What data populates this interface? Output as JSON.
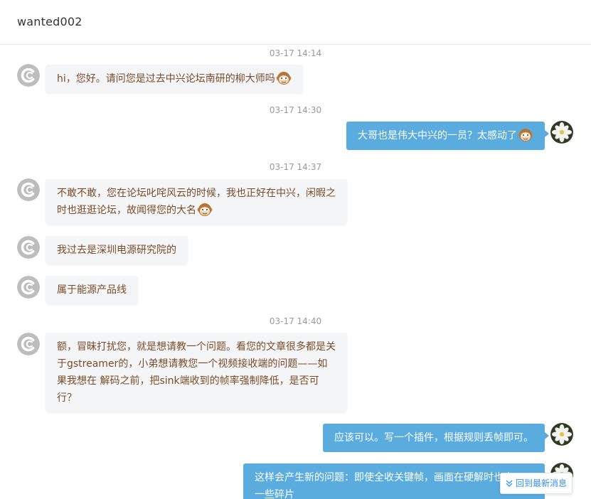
{
  "header": {
    "title": "wanted002"
  },
  "timestamps": [
    "03-17 14:14",
    "03-17 14:30",
    "03-17 14:37",
    "03-17 14:40"
  ],
  "messages": [
    {
      "text": "hi，您好。请问您是过去中兴论坛南研的柳大师吗"
    },
    {
      "text": "大哥也是伟大中兴的一员？太感动了"
    },
    {
      "line1": "不敢不敢，您在论坛叱咤风云的时候，我也正好在中兴，闲暇之",
      "line2": "时也逛逛论坛，故闻得您的大名"
    },
    {
      "text": "我过去是深圳电源研究院的"
    },
    {
      "text": "属于能源产品线"
    },
    {
      "line1": "额，冒昧打扰您，就是想请教一个问题。看您的文章很多都是关",
      "line2": "于gstreamer的，小弟想请教您一个视频接收端的问题——如",
      "line3": "果我想在  解码之前，把sink端收到的帧率强制降低，是否可",
      "line4": "行？"
    },
    {
      "text": "应该可以。写一个插件，根据规则丢帧即可。"
    },
    {
      "line1": "这样会产生新的问题：即使全收关键帧，画面在硬解时也会",
      "line2": "一些碎片"
    }
  ],
  "back_to_latest": {
    "label": "回到最新消息"
  },
  "colors": {
    "out_bubble": "#5aabde",
    "in_bubble": "#f4f5f6",
    "in_text": "#7a4b2a",
    "timestamp": "#999999"
  },
  "icons": {
    "sender_avatar": "c-logo-avatar",
    "self_avatar": "flower-avatar",
    "emoji": "monkey-emoji",
    "back_icon": "double-chevron-down-icon"
  }
}
